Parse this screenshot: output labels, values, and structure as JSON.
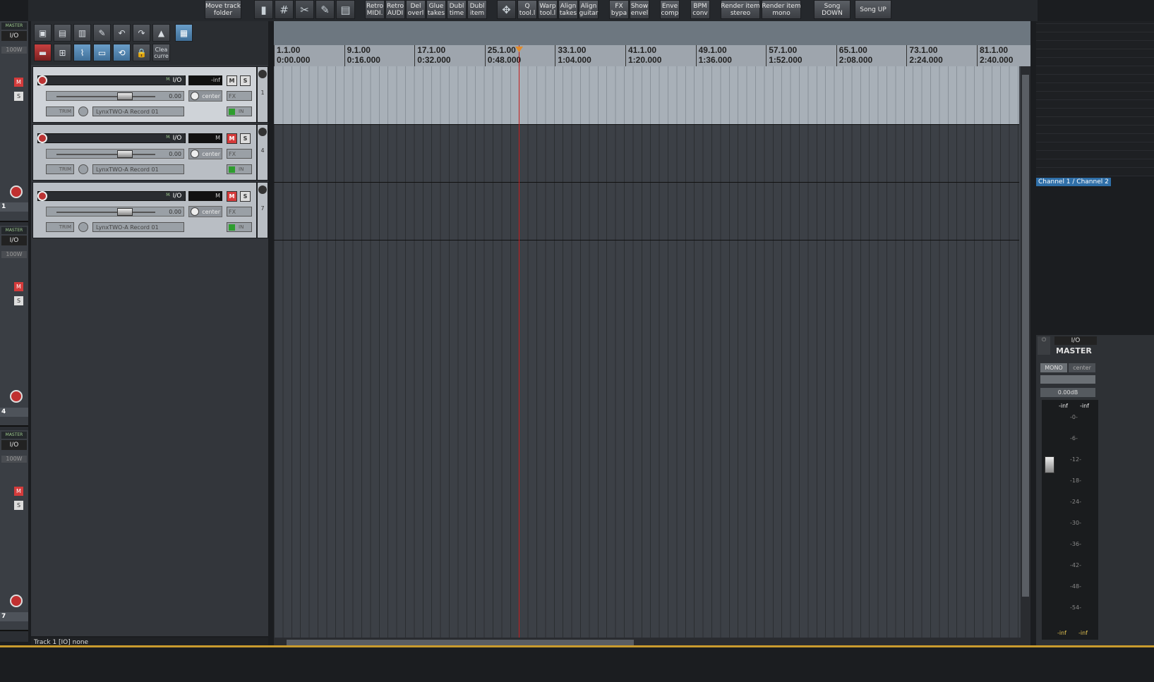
{
  "toolbar": {
    "buttons": [
      {
        "label": "Move track\nfolder"
      },
      {
        "label": "Retro\nMIDI."
      },
      {
        "label": "Retro\nAUDI"
      },
      {
        "label": "Del\noverl"
      },
      {
        "label": "Glue\ntakes"
      },
      {
        "label": "Dubl\ntime"
      },
      {
        "label": "Dubl\nitem"
      },
      {
        "label": "Q\ntool.l"
      },
      {
        "label": "Warp\ntool.l"
      },
      {
        "label": "Align\ntakes"
      },
      {
        "label": "Align\nguitar"
      },
      {
        "label": "FX\nbypa"
      },
      {
        "label": "Show\nenvel"
      },
      {
        "label": "Enve\ncomp"
      },
      {
        "label": "BPM\nconv"
      },
      {
        "label": "Render item\nstereo"
      },
      {
        "label": "Render item\nmono"
      },
      {
        "label": "Song\nDOWN"
      },
      {
        "label": "Song UP"
      }
    ],
    "clear_label": "Clea\ncurre"
  },
  "ruler": {
    "marks": [
      {
        "bar": "1.1.00",
        "time": "0:00.000"
      },
      {
        "bar": "9.1.00",
        "time": "0:16.000"
      },
      {
        "bar": "17.1.00",
        "time": "0:32.000"
      },
      {
        "bar": "25.1.00",
        "time": "0:48.000"
      },
      {
        "bar": "33.1.00",
        "time": "1:04.000"
      },
      {
        "bar": "41.1.00",
        "time": "1:20.000"
      },
      {
        "bar": "49.1.00",
        "time": "1:36.000"
      },
      {
        "bar": "57.1.00",
        "time": "1:52.000"
      },
      {
        "bar": "65.1.00",
        "time": "2:08.000"
      },
      {
        "bar": "73.1.00",
        "time": "2:24.000"
      },
      {
        "bar": "81.1.00",
        "time": "2:40.000"
      }
    ]
  },
  "tracks": [
    {
      "number": "1",
      "meter": "-inf",
      "volume": "0.00",
      "pan": "center",
      "input": "LynxTWO-A Record 01",
      "io": "I/O",
      "mute": "M",
      "solo": "S",
      "fx": "FX",
      "trim": "TRIM",
      "in": "IN",
      "tag": "MASTER",
      "muted": false
    },
    {
      "number": "4",
      "meter": "M",
      "volume": "0.00",
      "pan": "center",
      "input": "LynxTWO-A Record 01",
      "io": "I/O",
      "mute": "M",
      "solo": "S",
      "fx": "FX",
      "trim": "TRIM",
      "in": "IN",
      "tag": "MASTER",
      "muted": true
    },
    {
      "number": "7",
      "meter": "M",
      "volume": "0.00",
      "pan": "center",
      "input": "LynxTWO-A Record 01",
      "io": "I/O",
      "mute": "M",
      "solo": "S",
      "fx": "FX",
      "trim": "TRIM",
      "in": "IN",
      "tag": "MASTER",
      "muted": true
    }
  ],
  "mixer_strips": [
    {
      "number": "1",
      "tag": "MASTER",
      "io": "I/O",
      "vol": "100W"
    },
    {
      "number": "4",
      "tag": "MASTER",
      "io": "I/O",
      "vol": "100W"
    },
    {
      "number": "7",
      "tag": "MASTER",
      "io": "I/O",
      "vol": "100W"
    }
  ],
  "master": {
    "title": "MASTER",
    "io": "I/O",
    "mono": "MONO",
    "pan": "center",
    "gain": "0.00dB",
    "peak_l": "-inf",
    "peak_r": "-inf",
    "scale": [
      "-0-",
      "-6-",
      "-12-",
      "-18-",
      "-24-",
      "-30-",
      "-36-",
      "-42-",
      "-48-",
      "-54-"
    ],
    "bottom_l": "-inf",
    "bottom_r": "-inf"
  },
  "channel_label": "Channel 1 / Channel 2",
  "status": "Track 1 [IO] none",
  "colors": {
    "cursor": "#c41d1d",
    "mute_active": "#d43b3b",
    "accent": "#2f6fa8"
  }
}
